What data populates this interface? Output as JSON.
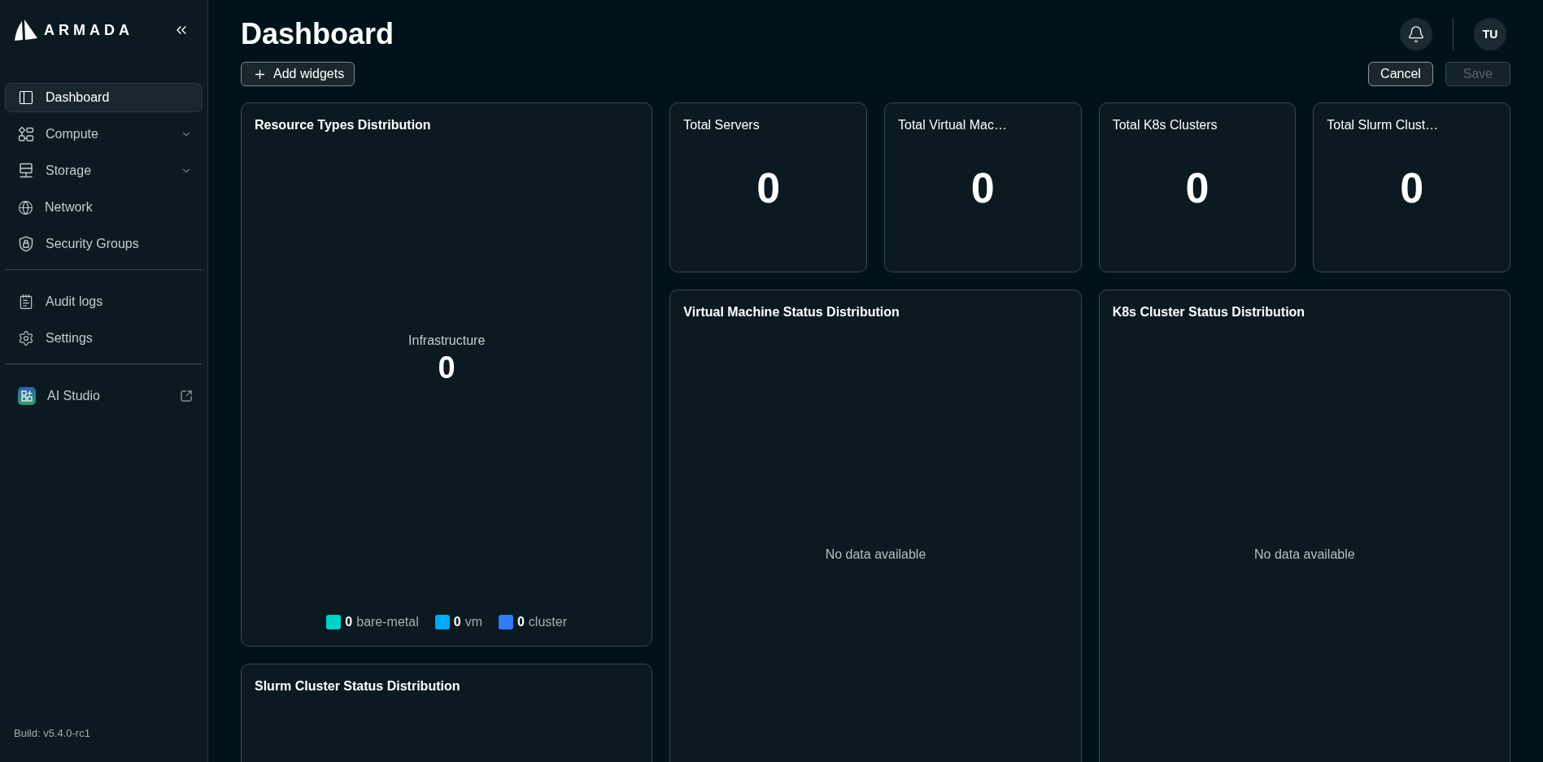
{
  "sidebar": {
    "logo_text": "ARMADA",
    "nav_sections": [
      {
        "items": [
          {
            "label": "Dashboard",
            "selected": true,
            "expandable": false,
            "external": false
          },
          {
            "label": "Compute",
            "selected": false,
            "expandable": true,
            "external": false
          },
          {
            "label": "Storage",
            "selected": false,
            "expandable": true,
            "external": false
          },
          {
            "label": "Network",
            "selected": false,
            "expandable": false,
            "external": false
          },
          {
            "label": "Security Groups",
            "selected": false,
            "expandable": false,
            "external": false
          }
        ]
      },
      {
        "items": [
          {
            "label": "Audit logs",
            "selected": false,
            "expandable": false,
            "external": false
          },
          {
            "label": "Settings",
            "selected": false,
            "expandable": false,
            "external": false
          }
        ]
      },
      {
        "items": [
          {
            "label": "AI Studio",
            "selected": false,
            "expandable": false,
            "external": true
          }
        ]
      }
    ],
    "build": "Build: v5.4.0-rc1"
  },
  "header": {
    "title": "Dashboard",
    "add_widgets": "Add widgets",
    "avatar": "TU",
    "actions": [
      {
        "label": "Cancel",
        "disabled": false
      },
      {
        "label": "Save",
        "disabled": true
      }
    ]
  },
  "resource_types": {
    "title": "Resource Types Distribution",
    "center_label": "Infrastructure",
    "center_value": "0",
    "legend": [
      {
        "value": "0",
        "label": "bare-metal",
        "color": "#00d3c7"
      },
      {
        "value": "0",
        "label": "vm",
        "color": "#00a9f7"
      },
      {
        "value": "0",
        "label": "cluster",
        "color": "#2f7cf6"
      }
    ]
  },
  "stat_cards": [
    {
      "title": "Total Servers",
      "value": "0"
    },
    {
      "title": "Total Virtual Mac…",
      "value": "0"
    },
    {
      "title": "Total K8s Clusters",
      "value": "0"
    },
    {
      "title": "Total Slurm Clust…",
      "value": "0"
    }
  ],
  "status_widgets": [
    {
      "title": "Virtual Machine Status Distribution",
      "empty_text": "No data available"
    },
    {
      "title": "K8s Cluster Status Distribution",
      "empty_text": "No data available"
    },
    {
      "title": "Slurm Cluster Status Distribution"
    }
  ]
}
